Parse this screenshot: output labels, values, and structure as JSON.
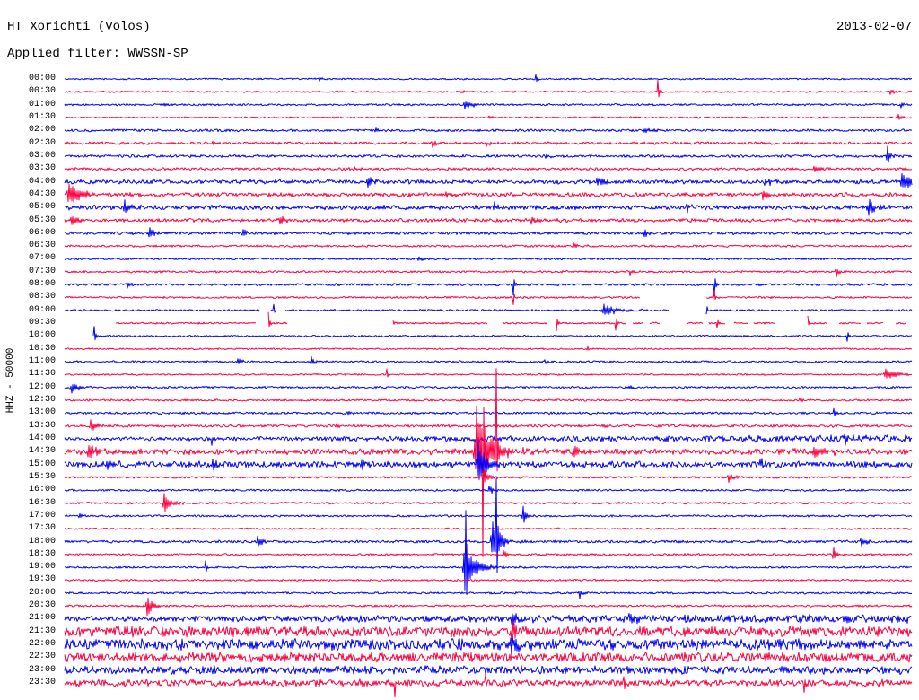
{
  "chart_data": {
    "type": "line",
    "title": "HT Xorichti (Volos)",
    "date": "2013-02-07",
    "subtitle": "Applied filter: WWSSN-SP",
    "ylabel": "HHZ - 50000",
    "xlim": [
      0,
      30
    ],
    "traces": [
      {
        "label": "00:00",
        "color": "#0000ff",
        "noise": 0.07,
        "events": [
          [
            16.7,
            0.35,
            0.15
          ],
          [
            9.0,
            0.15,
            0.3
          ]
        ],
        "gaps": []
      },
      {
        "label": "00:30",
        "color": "#ff0040",
        "noise": 0.07,
        "events": [
          [
            21.0,
            0.85,
            0.12
          ],
          [
            14.0,
            0.15,
            0.3
          ],
          [
            29.2,
            0.2,
            0.4
          ]
        ],
        "gaps": []
      },
      {
        "label": "01:00",
        "color": "#0000ff",
        "noise": 0.09,
        "events": [
          [
            14.1,
            0.3,
            0.6
          ],
          [
            29.6,
            0.2,
            0.3
          ],
          [
            3.5,
            0.15,
            0.3
          ]
        ],
        "gaps": []
      },
      {
        "label": "01:30",
        "color": "#ff0040",
        "noise": 0.07,
        "events": [
          [
            29.5,
            0.25,
            0.3
          ],
          [
            15.0,
            0.12,
            0.3
          ]
        ],
        "gaps": []
      },
      {
        "label": "02:00",
        "color": "#0000ff",
        "noise": 0.11,
        "events": [
          [
            11.0,
            0.2,
            0.5
          ],
          [
            20.5,
            0.2,
            0.5
          ]
        ],
        "gaps": []
      },
      {
        "label": "02:30",
        "color": "#ff0040",
        "noise": 0.12,
        "events": [
          [
            13.0,
            0.3,
            0.4
          ],
          [
            14.9,
            0.25,
            0.4
          ],
          [
            5.2,
            0.2,
            0.3
          ]
        ],
        "gaps": []
      },
      {
        "label": "03:00",
        "color": "#0000ff",
        "noise": 0.12,
        "events": [
          [
            29.1,
            0.7,
            0.25
          ],
          [
            17.0,
            0.2,
            0.4
          ]
        ],
        "gaps": []
      },
      {
        "label": "03:30",
        "color": "#ff0040",
        "noise": 0.12,
        "events": [
          [
            26.5,
            0.3,
            0.4
          ],
          [
            10.2,
            0.2,
            0.4
          ]
        ],
        "gaps": []
      },
      {
        "label": "04:00",
        "color": "#0000ff",
        "noise": 0.18,
        "events": [
          [
            10.7,
            0.35,
            0.5
          ],
          [
            18.8,
            0.4,
            0.6
          ],
          [
            29.6,
            0.7,
            0.8
          ],
          [
            24.8,
            0.3,
            0.5
          ]
        ],
        "gaps": []
      },
      {
        "label": "04:30",
        "color": "#ff0040",
        "noise": 0.18,
        "events": [
          [
            0.1,
            0.85,
            0.9
          ],
          [
            24.7,
            0.45,
            0.5
          ],
          [
            13.5,
            0.25,
            0.5
          ]
        ],
        "gaps": []
      },
      {
        "label": "05:00",
        "color": "#0000ff",
        "noise": 0.2,
        "events": [
          [
            2.1,
            0.45,
            0.5
          ],
          [
            28.4,
            0.5,
            0.6
          ],
          [
            15.2,
            0.3,
            0.5
          ],
          [
            22.0,
            0.3,
            0.5
          ]
        ],
        "gaps": []
      },
      {
        "label": "05:30",
        "color": "#ff0040",
        "noise": 0.15,
        "events": [
          [
            0.2,
            0.4,
            0.6
          ],
          [
            7.6,
            0.35,
            0.4
          ],
          [
            16.5,
            0.25,
            0.4
          ]
        ],
        "gaps": []
      },
      {
        "label": "06:00",
        "color": "#0000ff",
        "noise": 0.13,
        "events": [
          [
            3.0,
            0.45,
            0.4
          ],
          [
            6.3,
            0.3,
            0.4
          ],
          [
            20.5,
            0.25,
            0.4
          ]
        ],
        "gaps": []
      },
      {
        "label": "06:30",
        "color": "#ff0040",
        "noise": 0.09,
        "events": [
          [
            18.0,
            0.2,
            0.4
          ]
        ],
        "gaps": []
      },
      {
        "label": "07:00",
        "color": "#0000ff",
        "noise": 0.09,
        "events": [
          [
            12.5,
            0.2,
            0.4
          ]
        ],
        "gaps": []
      },
      {
        "label": "07:30",
        "color": "#ff0040",
        "noise": 0.09,
        "events": [
          [
            27.3,
            0.45,
            0.2
          ],
          [
            20.0,
            0.2,
            0.3
          ]
        ],
        "gaps": []
      },
      {
        "label": "08:00",
        "color": "#0000ff",
        "noise": 0.11,
        "events": [
          [
            2.2,
            0.3,
            0.3
          ],
          [
            15.9,
            0.8,
            0.1
          ],
          [
            23.0,
            0.9,
            0.1
          ]
        ],
        "gaps": []
      },
      {
        "label": "08:30",
        "color": "#ff0040",
        "noise": 0.09,
        "events": [
          [
            15.9,
            0.5,
            0.1
          ],
          [
            23.0,
            0.6,
            0.1
          ]
        ],
        "gaps": [
          [
            20.4,
            22.7
          ]
        ]
      },
      {
        "label": "09:00",
        "color": "#0000ff",
        "noise": 0.09,
        "events": [
          [
            7.4,
            0.4,
            0.1
          ],
          [
            19.0,
            0.45,
            1.0
          ],
          [
            22.7,
            0.9,
            0.1
          ]
        ],
        "gaps": [
          [
            6.9,
            7.3
          ],
          [
            7.5,
            7.8
          ],
          [
            21.4,
            22.7
          ]
        ]
      },
      {
        "label": "09:30",
        "color": "#ff0040",
        "noise": 0.08,
        "events": [
          [
            7.2,
            0.9,
            0.1
          ],
          [
            11.6,
            0.6,
            0.1
          ],
          [
            17.4,
            0.6,
            0.1
          ],
          [
            19.5,
            0.6,
            0.1
          ],
          [
            26.3,
            0.6,
            0.1
          ],
          [
            23.1,
            0.4,
            0.1
          ]
        ],
        "gaps": [
          [
            0,
            1.8
          ],
          [
            6.8,
            7.2
          ],
          [
            7.9,
            11.6
          ],
          [
            15.0,
            15.5
          ],
          [
            17.1,
            17.4
          ],
          [
            19.9,
            20.1
          ],
          [
            20.5,
            20.7
          ],
          [
            21.1,
            22.0
          ],
          [
            22.6,
            22.8
          ],
          [
            23.4,
            23.7
          ],
          [
            24.2,
            24.4
          ],
          [
            25.2,
            26.3
          ],
          [
            27.0,
            27.4
          ],
          [
            28.2,
            28.4
          ],
          [
            29.0,
            29.4
          ],
          [
            29.8,
            30
          ]
        ]
      },
      {
        "label": "10:00",
        "color": "#0000ff",
        "noise": 0.08,
        "events": [
          [
            1.05,
            0.8,
            0.1
          ],
          [
            27.7,
            0.4,
            0.15
          ],
          [
            13.0,
            0.15,
            0.3
          ]
        ],
        "gaps": [
          [
            0,
            1.0
          ]
        ]
      },
      {
        "label": "10:30",
        "color": "#ff0040",
        "noise": 0.07,
        "events": [
          [
            18.5,
            0.15,
            0.3
          ]
        ],
        "gaps": []
      },
      {
        "label": "11:00",
        "color": "#0000ff",
        "noise": 0.09,
        "events": [
          [
            8.7,
            0.35,
            0.3
          ],
          [
            6.1,
            0.25,
            0.3
          ],
          [
            17.0,
            0.2,
            0.3
          ]
        ],
        "gaps": []
      },
      {
        "label": "11:30",
        "color": "#ff0040",
        "noise": 0.07,
        "events": [
          [
            11.4,
            0.4,
            0.1
          ],
          [
            29.0,
            0.4,
            0.9
          ]
        ],
        "gaps": []
      },
      {
        "label": "12:00",
        "color": "#0000ff",
        "noise": 0.09,
        "events": [
          [
            0.2,
            0.4,
            0.6
          ],
          [
            20.0,
            0.15,
            0.3
          ]
        ],
        "gaps": []
      },
      {
        "label": "12:30",
        "color": "#ff0040",
        "noise": 0.09,
        "events": [
          [
            26.0,
            0.15,
            0.3
          ]
        ],
        "gaps": []
      },
      {
        "label": "13:00",
        "color": "#0000ff",
        "noise": 0.1,
        "events": [
          [
            27.2,
            0.35,
            0.2
          ],
          [
            10.0,
            0.15,
            0.3
          ]
        ],
        "gaps": []
      },
      {
        "label": "13:30",
        "color": "#ff0040",
        "noise": 0.12,
        "events": [
          [
            0.9,
            0.45,
            0.5
          ],
          [
            9.6,
            0.25,
            0.3
          ],
          [
            19.0,
            0.2,
            0.3
          ]
        ],
        "gaps": []
      },
      {
        "label": "14:00",
        "color": "#0000ff",
        "noise": [
          0.15,
          0.32
        ],
        "events": [
          [
            5.2,
            0.4,
            0.15
          ],
          [
            14.5,
            0.35,
            0.6
          ],
          [
            27.6,
            0.4,
            0.6
          ]
        ],
        "gaps": []
      },
      {
        "label": "14:30",
        "color": "#ff0040",
        "noise": 0.27,
        "events": [
          [
            14.5,
            3.5,
            1.0
          ],
          [
            14.8,
            6.3,
            0.05
          ],
          [
            15.3,
            5.8,
            0.05
          ],
          [
            0.8,
            0.5,
            0.6
          ],
          [
            18.0,
            0.4,
            0.8
          ],
          [
            26.5,
            0.45,
            0.8
          ]
        ],
        "gaps": []
      },
      {
        "label": "15:00",
        "color": "#0000ff",
        "noise": 0.27,
        "events": [
          [
            14.6,
            1.9,
            0.6
          ],
          [
            5.2,
            0.5,
            0.3
          ],
          [
            10.5,
            0.4,
            0.4
          ],
          [
            24.6,
            0.4,
            0.5
          ],
          [
            1.5,
            0.4,
            0.5
          ]
        ],
        "gaps": []
      },
      {
        "label": "15:30",
        "color": "#ff0040",
        "noise": 0.09,
        "events": [
          [
            23.5,
            0.4,
            0.4
          ],
          [
            14.8,
            0.6,
            0.4
          ]
        ],
        "gaps": []
      },
      {
        "label": "16:00",
        "color": "#0000ff",
        "noise": 0.09,
        "events": [
          [
            15.0,
            0.3,
            0.4
          ]
        ],
        "gaps": []
      },
      {
        "label": "16:30",
        "color": "#ff0040",
        "noise": 0.09,
        "events": [
          [
            3.5,
            0.8,
            0.5
          ]
        ],
        "gaps": []
      },
      {
        "label": "17:00",
        "color": "#0000ff",
        "noise": 0.09,
        "events": [
          [
            16.2,
            0.8,
            0.2
          ],
          [
            0.5,
            0.2,
            0.3
          ]
        ],
        "gaps": []
      },
      {
        "label": "17:30",
        "color": "#ff0040",
        "noise": 0.07,
        "events": [],
        "gaps": []
      },
      {
        "label": "18:00",
        "color": "#0000ff",
        "noise": 0.12,
        "events": [
          [
            6.8,
            0.35,
            0.4
          ],
          [
            15.1,
            1.6,
            0.6
          ],
          [
            15.3,
            4.0,
            0.08
          ],
          [
            28.2,
            0.3,
            0.4
          ]
        ],
        "gaps": []
      },
      {
        "label": "18:30",
        "color": "#ff0040",
        "noise": 0.09,
        "events": [
          [
            27.2,
            0.6,
            0.2
          ],
          [
            15.5,
            0.3,
            0.3
          ]
        ],
        "gaps": []
      },
      {
        "label": "19:00",
        "color": "#0000ff",
        "noise": 0.09,
        "events": [
          [
            14.1,
            1.8,
            0.8
          ],
          [
            14.2,
            3.3,
            0.08
          ],
          [
            5.0,
            0.45,
            0.15
          ]
        ],
        "gaps": []
      },
      {
        "label": "19:30",
        "color": "#ff0040",
        "noise": 0.08,
        "events": [],
        "gaps": []
      },
      {
        "label": "20:00",
        "color": "#0000ff",
        "noise": 0.09,
        "events": [
          [
            18.2,
            0.4,
            0.2
          ]
        ],
        "gaps": []
      },
      {
        "label": "20:30",
        "color": "#ff0040",
        "noise": 0.09,
        "events": [
          [
            2.9,
            0.8,
            0.4
          ]
        ],
        "gaps": []
      },
      {
        "label": "21:00",
        "color": "#0000ff",
        "noise": [
          0.22,
          0.38
        ],
        "events": [
          [
            15.8,
            0.5,
            0.6
          ],
          [
            20.0,
            0.45,
            0.6
          ]
        ],
        "gaps": []
      },
      {
        "label": "21:30",
        "color": "#ff0040",
        "noise": 0.45,
        "events": [
          [
            15.8,
            0.7,
            0.5
          ]
        ],
        "gaps": []
      },
      {
        "label": "22:00",
        "color": "#0000ff",
        "noise": 0.48,
        "events": [
          [
            15.8,
            0.7,
            0.5
          ]
        ],
        "gaps": []
      },
      {
        "label": "22:30",
        "color": "#ff0040",
        "noise": 0.42,
        "events": [],
        "gaps": []
      },
      {
        "label": "23:00",
        "color": "#0000ff",
        "noise": 0.36,
        "events": [],
        "gaps": []
      },
      {
        "label": "23:30",
        "color": "#ff0040",
        "noise": 0.3,
        "events": [
          [
            11.7,
            1.1,
            0.08
          ],
          [
            14.9,
            0.9,
            0.08
          ],
          [
            26.2,
            0.8,
            0.08
          ],
          [
            19.8,
            0.6,
            0.08
          ]
        ],
        "gaps": []
      }
    ]
  }
}
